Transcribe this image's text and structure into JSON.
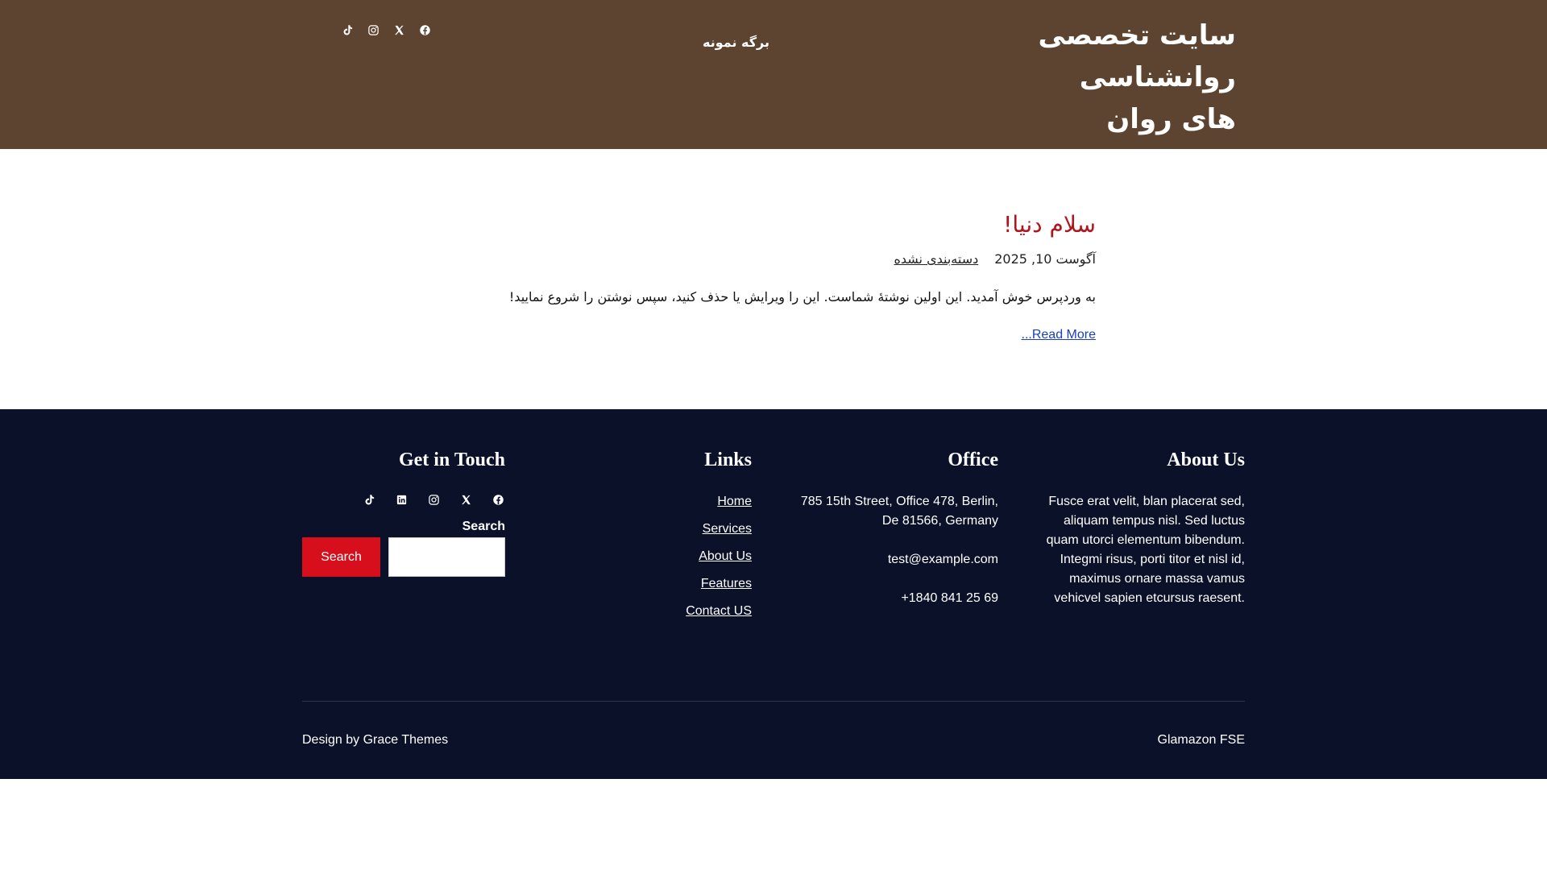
{
  "header": {
    "site_title": "سایت تخصصی روانشناسی های روان",
    "nav": [
      {
        "label": "برگه نمونه"
      }
    ],
    "social_icons": [
      "tiktok-icon",
      "instagram-icon",
      "x-icon",
      "facebook-icon"
    ],
    "background_color": "#5c4430"
  },
  "post": {
    "title": "سلام دنیا!",
    "date": "آگوست 10, 2025",
    "category": "دسته‌بندی نشده",
    "excerpt": "به وردپرس خوش آمدید. این اولین نوشتهٔ شماست. این را ویرایش یا حذف کنید، سپس نوشتن را شروع نمایید!",
    "read_more": "...Read More",
    "title_color": "#b0141c",
    "link_color": "#1a3fbf"
  },
  "footer": {
    "background_color": "#0b1129",
    "about": {
      "heading": "About Us",
      "text": "Fusce erat velit, blan placerat sed, aliquam tempus nisl. Sed luctus quam utorci elementum bibendum. Integmi risus, porti titor et nisl id, maximus ornare massa vamus vehicvel sapien etcursus raesent."
    },
    "office": {
      "heading": "Office",
      "address": "785 15th Street, Office 478, Berlin, De 81566, Germany",
      "email": "test@example.com",
      "phone": "+1840 841 25 69"
    },
    "links": {
      "heading": "Links",
      "items": [
        {
          "label": "Home"
        },
        {
          "label": "Services"
        },
        {
          "label": "About Us"
        },
        {
          "label": "Features"
        },
        {
          "label": "Contact US"
        }
      ]
    },
    "contact": {
      "heading": "Get in Touch",
      "social_icons": [
        "tiktok-icon",
        "linkedin-icon",
        "instagram-icon",
        "x-icon",
        "facebook-icon"
      ],
      "search_label": "Search",
      "search_button": "Search",
      "search_value": ""
    },
    "credit_left": "Design by Grace Themes",
    "credit_right": "Glamazon FSE",
    "accent_color": "#d70f1c"
  }
}
